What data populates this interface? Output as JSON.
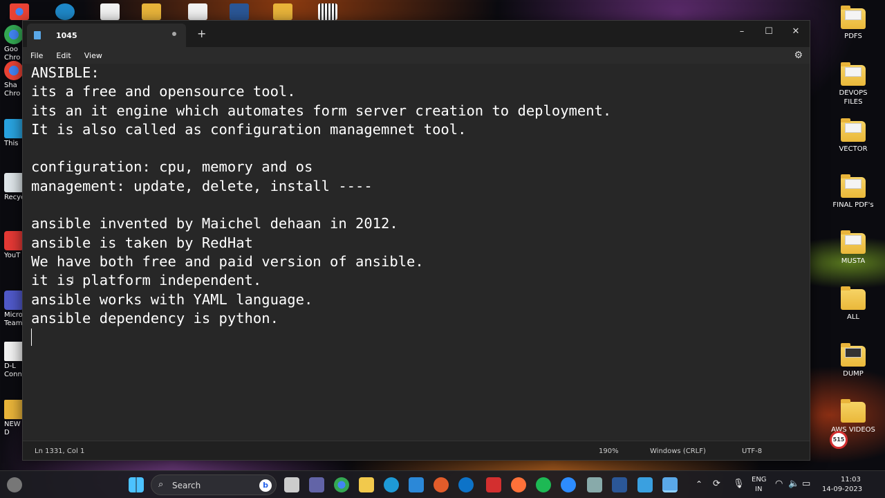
{
  "window": {
    "tab_title": "1045",
    "new_tab": "+",
    "minimize": "–",
    "maximize": "☐",
    "close": "✕"
  },
  "menu": {
    "items": [
      "File",
      "Edit",
      "View"
    ],
    "settings_icon": "gear-icon"
  },
  "editor": {
    "lines": [
      "ANSIBLE:",
      "its a free and opensource tool.",
      "its an it engine which automates form server creation to deployment.",
      "It is also called as configuration managemnet tool.",
      "",
      "configuration: cpu, memory and os",
      "management: update, delete, install ----",
      "",
      "ansible invented by Maichel dehaan in 2012.",
      "ansible is taken by RedHat",
      "We have both free and paid version of ansible.",
      "it is platform independent.",
      "ansible works with YAML language.",
      "ansible dependency is python."
    ]
  },
  "status": {
    "position": "Ln 1331, Col 1",
    "zoom": "190%",
    "line_ending": "Windows (CRLF)",
    "encoding": "UTF-8"
  },
  "desktop_right": [
    {
      "label": "PDFS"
    },
    {
      "label": "DEVOPS FILES"
    },
    {
      "label": "VECTOR"
    },
    {
      "label": "FINAL PDF's"
    },
    {
      "label": "MUSTA"
    },
    {
      "label": "ALL"
    },
    {
      "label": "DUMP"
    },
    {
      "label": "AWS VIDEOS"
    }
  ],
  "desktop_left": [
    {
      "label": "Goo Chro"
    },
    {
      "label": "Sha Chro"
    },
    {
      "label": "This"
    },
    {
      "label": "Recyc"
    },
    {
      "label": "YouT"
    },
    {
      "label": "Micro Teams"
    },
    {
      "label": "D-L Conn"
    },
    {
      "label": "NEW D"
    }
  ],
  "badge": "515",
  "taskbar": {
    "search_label": "Search",
    "bing_letter": "b",
    "lang_top": "ENG",
    "lang_bottom": "IN",
    "time": "11:03",
    "date": "14-09-2023"
  },
  "colors": {
    "editor_bg": "#272727",
    "titlebar_bg": "#1c1c1c",
    "text": "#ffffff"
  }
}
